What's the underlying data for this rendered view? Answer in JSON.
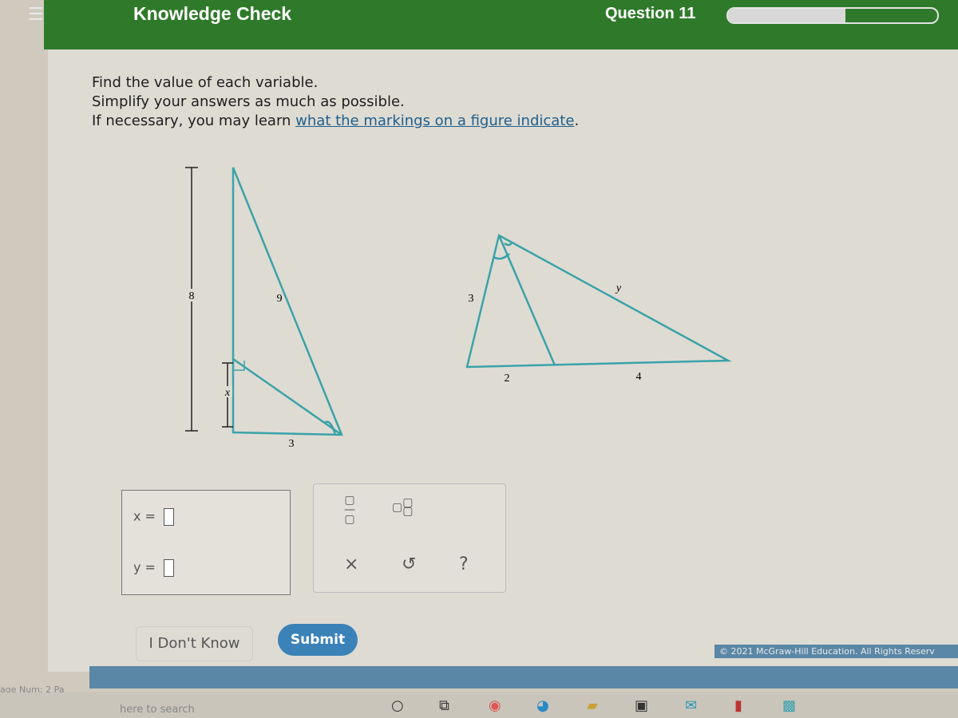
{
  "header": {
    "title": "Knowledge Check",
    "question": "Question 11",
    "progress_percent": 56,
    "menu_icon": "hamburger-icon"
  },
  "instructions": {
    "line1": "Find the value of each variable.",
    "line2": "Simplify your answers as much as possible.",
    "line3_prefix": "If necessary, you may learn ",
    "line3_link": "what the markings on a figure indicate",
    "line3_suffix": "."
  },
  "figure1": {
    "side_left": "8",
    "hypotenuse": "9",
    "bottom": "3",
    "segment": "x"
  },
  "figure2": {
    "left_side": "3",
    "bottom_left": "2",
    "bottom_right": "4",
    "long_side": "y"
  },
  "answers": {
    "x_label": "x =",
    "y_label": "y ="
  },
  "tools": {
    "fraction": "fraction-icon",
    "mixed_number": "mixed-number-icon",
    "clear": "×",
    "undo": "undo-icon",
    "help": "?"
  },
  "buttons": {
    "idk": "I Don't Know",
    "submit": "Submit"
  },
  "footer": {
    "copyright": "© 2021 McGraw-Hill Education. All Rights Reserv",
    "page_num": "age Num: 2   Pa"
  },
  "taskbar": {
    "search": "here to search"
  },
  "colors": {
    "header": "#2f7a2a",
    "accent": "#3b82b8",
    "figure_line": "#3aa3a8"
  }
}
